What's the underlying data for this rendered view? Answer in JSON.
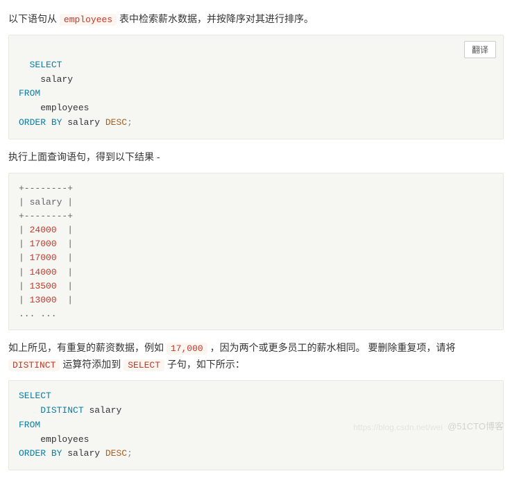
{
  "intro": {
    "prefix": "以下语句从 ",
    "code": "employees",
    "suffix": " 表中检索薪水数据，并按降序对其进行排序。"
  },
  "translate_label": "翻译",
  "sql1": {
    "SELECT": "SELECT",
    "salary": "salary",
    "FROM": "FROM",
    "employees": "employees",
    "ORDER": "ORDER",
    "BY": "BY",
    "salary2": "salary",
    "DESC": "DESC",
    "semi": ";"
  },
  "mid1": "执行上面查询语句，得到以下结果 -",
  "result": {
    "border": "+--------+",
    "header": "salary",
    "rows": [
      "24000",
      "17000",
      "17000",
      "14000",
      "13500",
      "13000"
    ],
    "ellipsis": "... ..."
  },
  "para2": {
    "a": "如上所见，有重复的薪资数据，例如 ",
    "code1": "17,000",
    "b": " ，因为两个或更多员工的薪水相同。 要删除重复项，请将 ",
    "code2": "DISTINCT",
    "c": " 运算符添加到 ",
    "code3": "SELECT",
    "d": " 子句，如下所示："
  },
  "sql2": {
    "SELECT": "SELECT",
    "DISTINCT": "DISTINCT",
    "salary": "salary",
    "FROM": "FROM",
    "employees": "employees",
    "ORDER": "ORDER",
    "BY": "BY",
    "salary2": "salary",
    "DESC": "DESC",
    "semi": ";"
  },
  "watermark": "@51CTO博客",
  "watermark2": "https://blog.csdn.net/wei"
}
